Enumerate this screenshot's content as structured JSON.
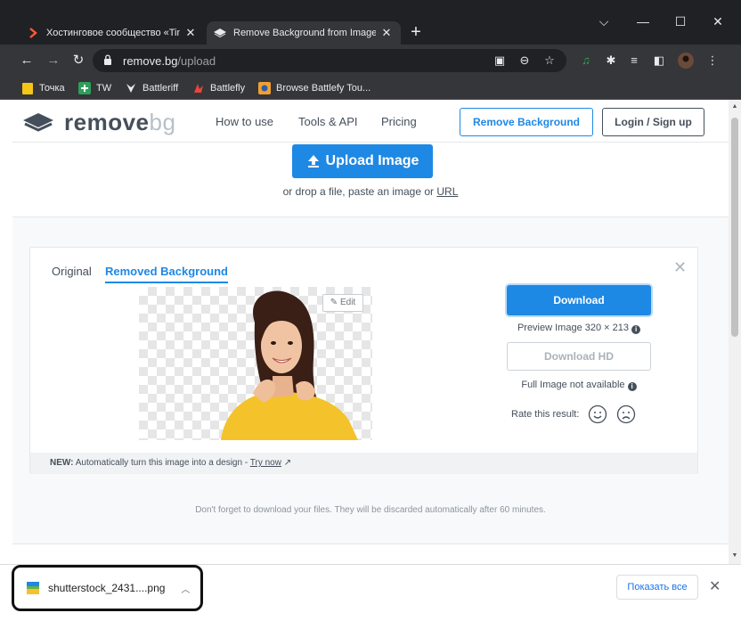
{
  "browser": {
    "tabs": [
      {
        "title": "Хостинговое сообщество «Timeweb»",
        "favicon": "chevron-favicon",
        "active": false
      },
      {
        "title": "Remove Background from Image",
        "favicon": "removebg-favicon",
        "active": true
      }
    ],
    "new_tab": "+",
    "address": {
      "host": "remove.bg",
      "path": "/upload"
    },
    "bookmarks": [
      {
        "label": "Точка",
        "icon": "yellow-square-icon"
      },
      {
        "label": "TW",
        "icon": "green-plus-icon"
      },
      {
        "label": "Battleriff",
        "icon": "battleriff-icon"
      },
      {
        "label": "Battlefly",
        "icon": "battlefly-icon"
      },
      {
        "label": "Browse Battlefy Tou...",
        "icon": "battlefy-icon"
      }
    ]
  },
  "site": {
    "logo": {
      "main": "remove",
      "accent": "bg"
    },
    "nav": [
      "How to use",
      "Tools & API",
      "Pricing"
    ],
    "remove_background_button": "Remove Background",
    "login_button": "Login / Sign up"
  },
  "upload": {
    "button": "Upload Image",
    "drop_text": "or drop a file, paste an image or",
    "url_link": "URL"
  },
  "result": {
    "tabs": {
      "original": "Original",
      "removed": "Removed Background"
    },
    "edit_button": "Edit",
    "download_button": "Download",
    "preview_info": "Preview Image 320 × 213",
    "download_hd_button": "Download HD",
    "full_image_info": "Full Image not available",
    "rate_label": "Rate this result:",
    "footer": {
      "new_label": "NEW:",
      "text": "Automatically turn this image into a design -",
      "link": "Try now"
    }
  },
  "notice": "Don't forget to download your files. They will be discarded automatically after 60 minutes.",
  "download_shelf": {
    "filename": "shutterstock_2431....png",
    "show_all": "Показать все"
  },
  "colors": {
    "accent": "#1e88e5",
    "chrome_dark": "#202124",
    "chrome_mid": "#35363a",
    "text": "#454f5b"
  }
}
